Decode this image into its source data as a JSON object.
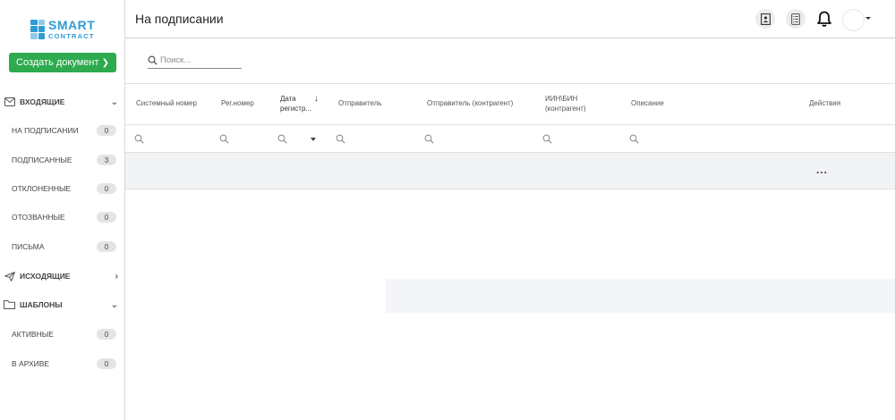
{
  "logo": {
    "line1": "SMART",
    "line2": "CONTRACT"
  },
  "sidebar": {
    "create_label": "Создать документ",
    "sections": [
      {
        "label": "ВХОДЯЩИЕ",
        "expanded": true,
        "icon": "envelope-icon"
      },
      {
        "label": "ИСХОДЯЩИЕ",
        "expanded": false,
        "icon": "paper-plane-icon"
      },
      {
        "label": "ШАБЛОНЫ",
        "expanded": true,
        "icon": "folder-icon"
      }
    ],
    "items": [
      {
        "label": "НА ПОДПИСАНИИ",
        "count": "0"
      },
      {
        "label": "ПОДПИСАННЫЕ",
        "count": "3"
      },
      {
        "label": "ОТКЛОНЕННЫЕ",
        "count": "0"
      },
      {
        "label": "ОТОЗВАННЫЕ",
        "count": "0"
      },
      {
        "label": "ПИСЬМА",
        "count": "0"
      },
      {
        "label": "АКТИВНЫЕ",
        "count": "0"
      },
      {
        "label": "В АРХИВЕ",
        "count": "0"
      }
    ]
  },
  "header": {
    "title": "На подписании"
  },
  "search": {
    "placeholder": "Поиск..."
  },
  "table": {
    "columns": [
      {
        "label": "Системный номер"
      },
      {
        "label": "Рег.номер"
      },
      {
        "label": "Дата регистр...",
        "line1": "Дата",
        "line2": "регистр...",
        "sorted": "desc"
      },
      {
        "label": "Отправитель"
      },
      {
        "label": "Отправитель (контрагент)"
      },
      {
        "label": "ИИН\\БИН (контрагент)",
        "line1": "ИИН\\БИН",
        "line2": "(контрагент)"
      },
      {
        "label": "Описание"
      },
      {
        "label": "Действия"
      }
    ],
    "row_actions": "..."
  },
  "colors": {
    "accent": "#2eaa4f",
    "brand": "#2f9bd4"
  }
}
